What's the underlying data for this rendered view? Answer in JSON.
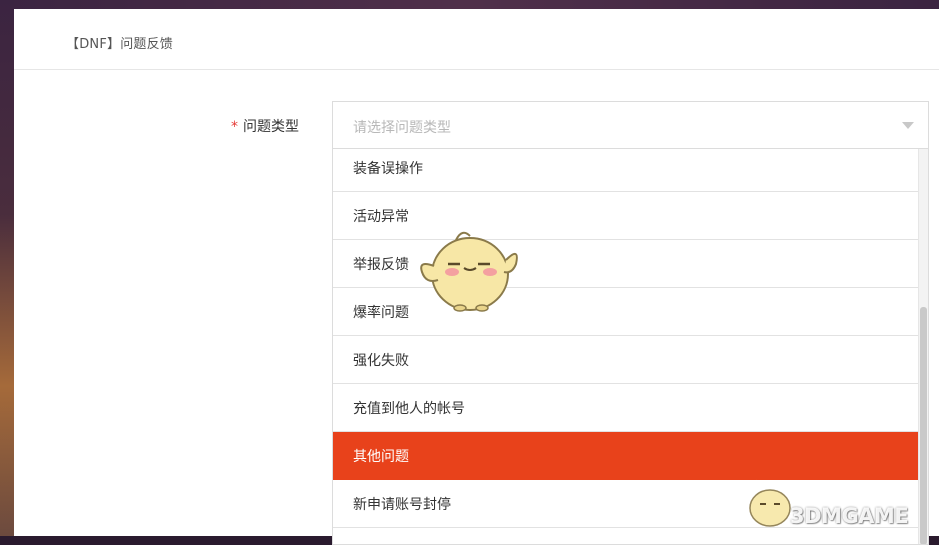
{
  "header": {
    "title": "【DNF】问题反馈"
  },
  "form": {
    "required_mark": "*",
    "field_label": "问题类型",
    "select": {
      "placeholder": "请选择问题类型",
      "selected_value": ""
    },
    "dropdown": {
      "items": [
        {
          "label": "装备误操作"
        },
        {
          "label": "活动异常"
        },
        {
          "label": "举报反馈"
        },
        {
          "label": "爆率问题"
        },
        {
          "label": "强化失败"
        },
        {
          "label": "充值到他人的帐号"
        },
        {
          "label": "其他问题",
          "highlighted": true
        },
        {
          "label": "新申请账号封停"
        }
      ],
      "highlight_color": "#e8421b"
    }
  },
  "watermark": {
    "text": "3DMGAME"
  },
  "colors": {
    "accent": "#e8421b",
    "required": "#e53935"
  }
}
